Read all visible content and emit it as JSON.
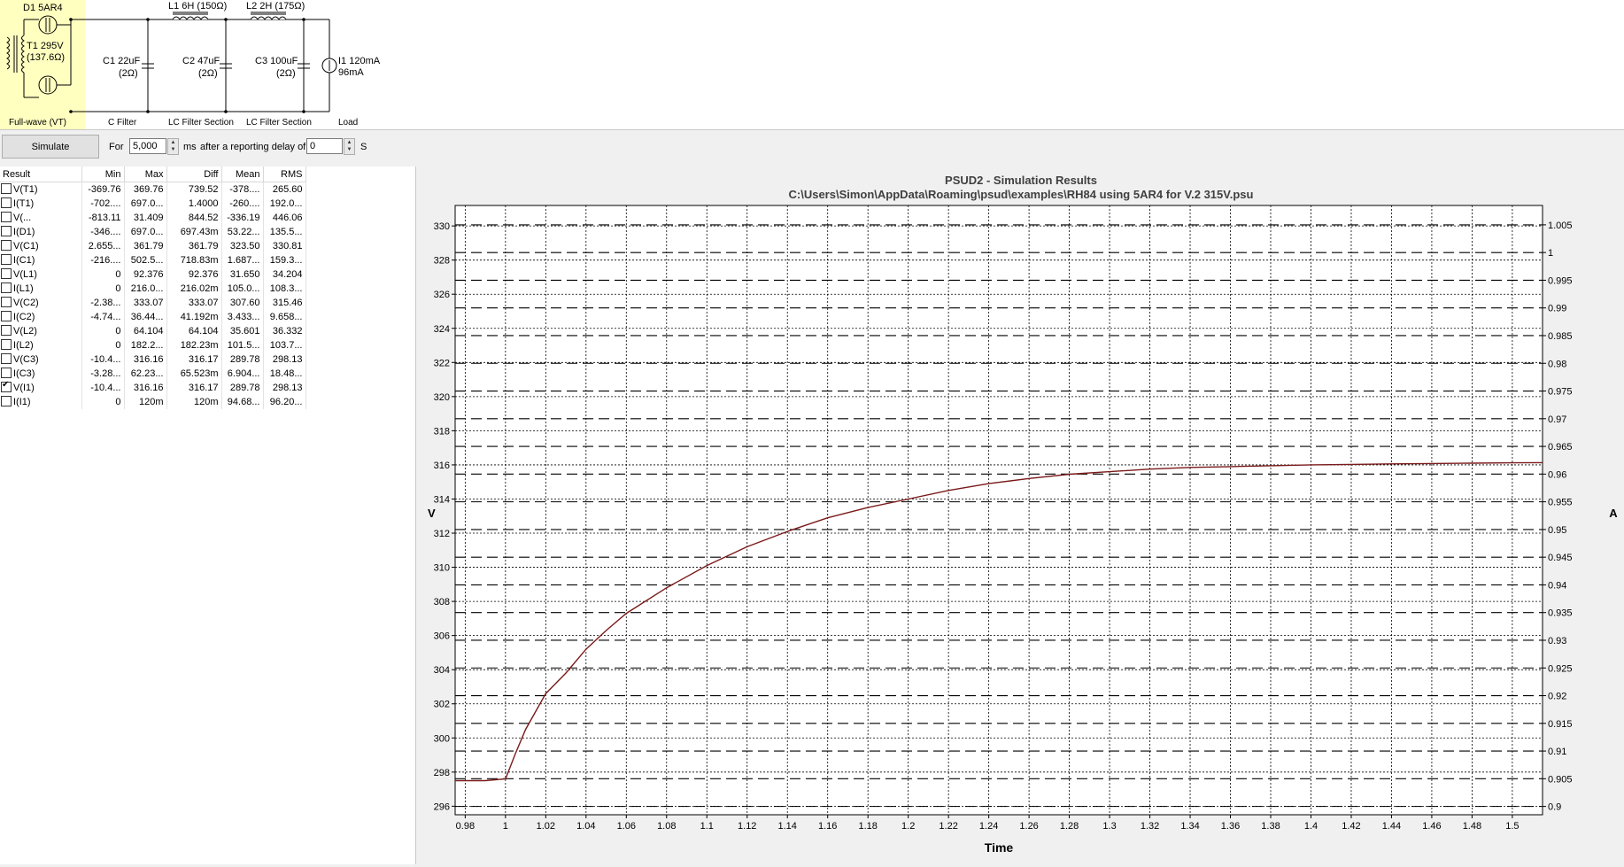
{
  "schematic": {
    "stages": [
      {
        "caption": "Full-wave (VT)",
        "label1": "D1 5AR4",
        "label2": "T1 295V",
        "label3": "(137.6Ω)"
      },
      {
        "caption": "C Filter",
        "label1": "C1 22uF",
        "label2": "(2Ω)"
      },
      {
        "caption": "LC Filter Section",
        "label1": "C2 47uF",
        "label2": "(2Ω)",
        "inductor": "L1 6H (150Ω)"
      },
      {
        "caption": "LC Filter Section",
        "label1": "C3 100uF",
        "label2": "(2Ω)",
        "inductor": "L2 2H (175Ω)"
      },
      {
        "caption": "Load",
        "label1": "I1 120mA",
        "label2": "96mA"
      }
    ]
  },
  "toolbar": {
    "simulate_label": "Simulate",
    "for_label": "For",
    "duration_value": "5,000",
    "ms_label": "ms",
    "delay_label": "after a reporting delay of",
    "delay_value": "0",
    "s_label": "S"
  },
  "table": {
    "headers": [
      "Result",
      "Min",
      "Max",
      "Diff",
      "Mean",
      "RMS"
    ],
    "rows": [
      {
        "name": "V(T1)",
        "checked": false,
        "min": "-369.76",
        "max": "369.76",
        "diff": "739.52",
        "mean": "-378....",
        "rms": "265.60"
      },
      {
        "name": "I(T1)",
        "checked": false,
        "min": "-702....",
        "max": "697.0...",
        "diff": "1.4000",
        "mean": "-260....",
        "rms": "192.0..."
      },
      {
        "name": "V(...",
        "checked": false,
        "min": "-813.11",
        "max": "31.409",
        "diff": "844.52",
        "mean": "-336.19",
        "rms": "446.06"
      },
      {
        "name": "I(D1)",
        "checked": false,
        "min": "-346....",
        "max": "697.0...",
        "diff": "697.43m",
        "mean": "53.22...",
        "rms": "135.5..."
      },
      {
        "name": "V(C1)",
        "checked": false,
        "min": "2.655...",
        "max": "361.79",
        "diff": "361.79",
        "mean": "323.50",
        "rms": "330.81"
      },
      {
        "name": "I(C1)",
        "checked": false,
        "min": "-216....",
        "max": "502.5...",
        "diff": "718.83m",
        "mean": "1.687...",
        "rms": "159.3..."
      },
      {
        "name": "V(L1)",
        "checked": false,
        "min": "0",
        "max": "92.376",
        "diff": "92.376",
        "mean": "31.650",
        "rms": "34.204"
      },
      {
        "name": "I(L1)",
        "checked": false,
        "min": "0",
        "max": "216.0...",
        "diff": "216.02m",
        "mean": "105.0...",
        "rms": "108.3..."
      },
      {
        "name": "V(C2)",
        "checked": false,
        "min": "-2.38...",
        "max": "333.07",
        "diff": "333.07",
        "mean": "307.60",
        "rms": "315.46"
      },
      {
        "name": "I(C2)",
        "checked": false,
        "min": "-4.74...",
        "max": "36.44...",
        "diff": "41.192m",
        "mean": "3.433...",
        "rms": "9.658..."
      },
      {
        "name": "V(L2)",
        "checked": false,
        "min": "0",
        "max": "64.104",
        "diff": "64.104",
        "mean": "35.601",
        "rms": "36.332"
      },
      {
        "name": "I(L2)",
        "checked": false,
        "min": "0",
        "max": "182.2...",
        "diff": "182.23m",
        "mean": "101.5...",
        "rms": "103.7..."
      },
      {
        "name": "V(C3)",
        "checked": false,
        "min": "-10.4...",
        "max": "316.16",
        "diff": "316.17",
        "mean": "289.78",
        "rms": "298.13"
      },
      {
        "name": "I(C3)",
        "checked": false,
        "min": "-3.28...",
        "max": "62.23...",
        "diff": "65.523m",
        "mean": "6.904...",
        "rms": "18.48..."
      },
      {
        "name": "V(I1)",
        "checked": true,
        "min": "-10.4...",
        "max": "316.16",
        "diff": "316.17",
        "mean": "289.78",
        "rms": "298.13"
      },
      {
        "name": "I(I1)",
        "checked": false,
        "min": "0",
        "max": "120m",
        "diff": "120m",
        "mean": "94.68...",
        "rms": "96.20..."
      }
    ]
  },
  "chart_data": {
    "type": "line",
    "title": "PSUD2 - Simulation Results",
    "subtitle": "C:\\Users\\Simon\\AppData\\Roaming\\psud\\examples\\RH84 using 5AR4 for V.2 315V.psu",
    "xlabel": "Time",
    "ylabel": "V",
    "y2label": "A",
    "xlim": [
      0.975,
      1.515
    ],
    "ylim": [
      295.5,
      331.2
    ],
    "y2lim": [
      0.8985,
      1.0085
    ],
    "xticks": [
      "0.98",
      "1",
      "1.02",
      "1.04",
      "1.06",
      "1.08",
      "1.1",
      "1.12",
      "1.14",
      "1.16",
      "1.18",
      "1.2",
      "1.22",
      "1.24",
      "1.26",
      "1.28",
      "1.3",
      "1.32",
      "1.34",
      "1.36",
      "1.38",
      "1.4",
      "1.42",
      "1.44",
      "1.46",
      "1.48",
      "1.5"
    ],
    "yticks": [
      "296",
      "298",
      "300",
      "302",
      "304",
      "306",
      "308",
      "310",
      "312",
      "314",
      "316",
      "318",
      "320",
      "322",
      "324",
      "326",
      "328",
      "330"
    ],
    "y2ticks": [
      "0.9",
      "0.905",
      "0.91",
      "0.915",
      "0.92",
      "0.925",
      "0.93",
      "0.935",
      "0.94",
      "0.945",
      "0.95",
      "0.955",
      "0.96",
      "0.965",
      "0.97",
      "0.975",
      "0.98",
      "0.985",
      "0.99",
      "0.995",
      "1",
      "1.005"
    ],
    "grid": true,
    "series": [
      {
        "color": "#7a1a1a",
        "x": [
          0.975,
          0.99,
          1.0,
          1.005,
          1.01,
          1.02,
          1.03,
          1.04,
          1.05,
          1.06,
          1.08,
          1.1,
          1.12,
          1.14,
          1.16,
          1.18,
          1.2,
          1.22,
          1.24,
          1.26,
          1.28,
          1.3,
          1.32,
          1.34,
          1.36,
          1.38,
          1.4,
          1.42,
          1.44,
          1.46,
          1.48,
          1.5,
          1.515
        ],
        "y": [
          297.5,
          297.5,
          297.6,
          299.1,
          300.5,
          302.6,
          303.8,
          305.2,
          306.3,
          307.3,
          308.8,
          310.1,
          311.2,
          312.1,
          312.9,
          313.5,
          314.0,
          314.5,
          314.9,
          315.2,
          315.45,
          315.6,
          315.75,
          315.85,
          315.9,
          315.95,
          316.0,
          316.03,
          316.06,
          316.08,
          316.1,
          316.12,
          316.13
        ]
      }
    ]
  }
}
